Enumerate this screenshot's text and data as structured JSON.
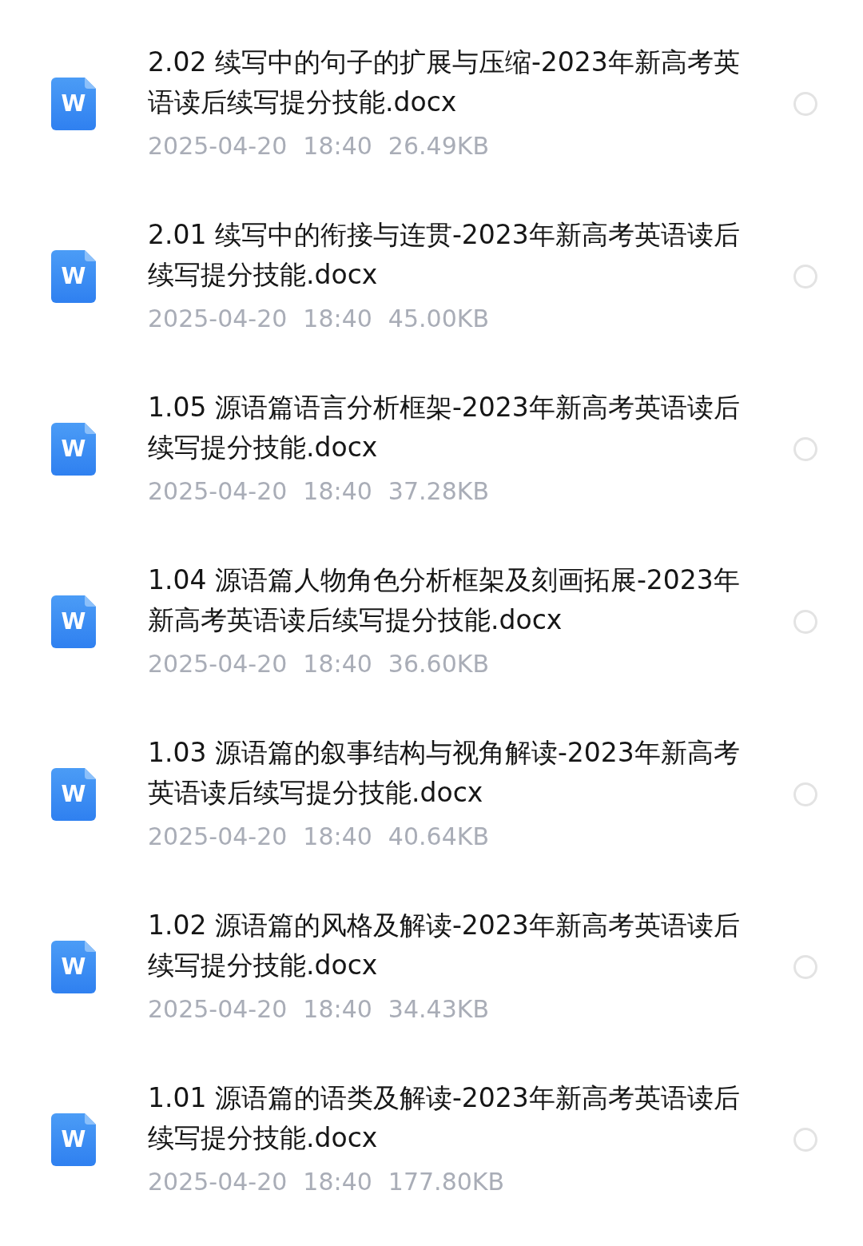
{
  "files": [
    {
      "type_letter": "W",
      "name": "2.02 续写中的句子的扩展与压缩-2023年新高考英语读后续写提分技能.docx",
      "date": "2025-04-20",
      "time": "18:40",
      "size": "26.49KB",
      "selected": false
    },
    {
      "type_letter": "W",
      "name": "2.01 续写中的衔接与连贯-2023年新高考英语读后续写提分技能.docx",
      "date": "2025-04-20",
      "time": "18:40",
      "size": "45.00KB",
      "selected": false
    },
    {
      "type_letter": "W",
      "name": "1.05 源语篇语言分析框架-2023年新高考英语读后续写提分技能.docx",
      "date": "2025-04-20",
      "time": "18:40",
      "size": "37.28KB",
      "selected": false
    },
    {
      "type_letter": "W",
      "name": "1.04 源语篇人物角色分析框架及刻画拓展-2023年新高考英语读后续写提分技能.docx",
      "date": "2025-04-20",
      "time": "18:40",
      "size": "36.60KB",
      "selected": false
    },
    {
      "type_letter": "W",
      "name": "1.03 源语篇的叙事结构与视角解读-2023年新高考英语读后续写提分技能.docx",
      "date": "2025-04-20",
      "time": "18:40",
      "size": "40.64KB",
      "selected": false
    },
    {
      "type_letter": "W",
      "name": "1.02 源语篇的风格及解读-2023年新高考英语读后续写提分技能.docx",
      "date": "2025-04-20",
      "time": "18:40",
      "size": "34.43KB",
      "selected": false
    },
    {
      "type_letter": "W",
      "name": "1.01 源语篇的语类及解读-2023年新高考英语读后续写提分技能.docx",
      "date": "2025-04-20",
      "time": "18:40",
      "size": "177.80KB",
      "selected": false
    }
  ]
}
